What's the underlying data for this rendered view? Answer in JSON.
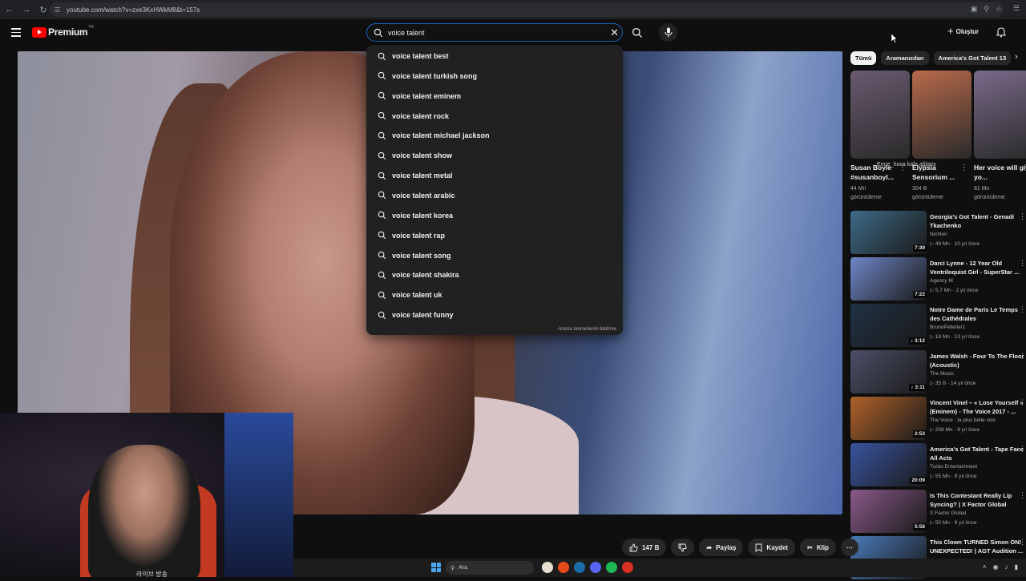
{
  "browser": {
    "url": "youtube.com/watch?v=zxe3KxHWkM8&t=157s"
  },
  "header": {
    "brand": "Premium",
    "country": "TR",
    "create_label": "Oluştur"
  },
  "search": {
    "value": "voice talent ",
    "suggestions": [
      "voice talent best",
      "voice talent turkish song",
      "voice talent eminem",
      "voice talent rock",
      "voice talent michael jackson",
      "voice talent show",
      "voice talent metal",
      "voice talent arabic",
      "voice talent korea",
      "voice talent rap",
      "voice talent song",
      "voice talent shakira",
      "voice talent uk",
      "voice talent funny"
    ],
    "report_label": "Arama tahminlerini bildirme"
  },
  "chips": [
    "Tümü",
    "Aramanızdan",
    "America's Got Talent 13"
  ],
  "shorts": [
    {
      "title": "Susan Boyle #susanboyl...",
      "views": "44 Mn",
      "views_label": "görüntüleme",
      "color": "#6a5a70"
    },
    {
      "title": "Elypsia Sensorium ...",
      "views": "304 B",
      "views_label": "görüntüleme",
      "color": "#b86a4a"
    },
    {
      "title": "Her voice will give yo...",
      "views": "81 Mn",
      "views_label": "görüntüleme",
      "color": "#7a6a8a"
    }
  ],
  "shorts_overlay": "Emre_hoca kafa ağlamı",
  "videos": [
    {
      "title": "Georgia's Got Talent - Genadi Tkachenko",
      "channel": "Nichleri",
      "meta": "▷ 49 Mn · 10 yıl önce",
      "duration": "7:39",
      "color": "#3f6b88"
    },
    {
      "title": "Darci Lynne - 12 Year Old Ventriloquist Girl - SuperStar ...",
      "channel": "Agency IK",
      "meta": "▷ 5,7 Mn · 2 yıl önce",
      "duration": "7:22",
      "color": "#6f86c9"
    },
    {
      "title": "Notre Dame de Paris Le Temps des Cathédrales",
      "channel": "BrunoPelletier1",
      "meta": "▷ 18 Mn · 13 yıl önce",
      "duration": "♪ 3:12",
      "color": "#1f3144"
    },
    {
      "title": "James Walsh - Four To The Floor (Acoustic)",
      "channel": "The Music",
      "meta": "▷ 35 B · 14 yıl önce",
      "duration": "♪ 3:11",
      "color": "#4c4f68"
    },
    {
      "title": "Vincent Vinel – « Lose Yourself » (Eminem) - The Voice 2017 - ...",
      "channel": "The Voice : la plus belle voix",
      "meta": "▷ 208 Mn · 9 yıl önce",
      "duration": "2:53",
      "color": "#b0622a"
    },
    {
      "title": "America's Got Talent - Tape Face All Acts",
      "channel": "Turbo Entertainment",
      "meta": "▷ 55 Mn · 9 yıl önce",
      "duration": "20:09",
      "color": "#3a55a0"
    },
    {
      "title": "Is This Contestant Really Lip Syncing? | X Factor Global",
      "channel": "X Factor Global",
      "meta": "▷ 50 Mn · 9 yıl önce",
      "duration": "5:56",
      "color": "#8a5a8a"
    },
    {
      "title": "This Clown TURNED Simon ON! UNEXPECTED! | AGT Audition ...",
      "channel": "",
      "meta": "",
      "duration": "",
      "color": "#4a7ab8"
    }
  ],
  "actions": {
    "likes": "147 B",
    "share": "Paylaş",
    "save": "Kaydet",
    "clip": "Klip"
  },
  "webcam_caption": "라이브 방송",
  "taskbar": {
    "search": "Ara"
  }
}
